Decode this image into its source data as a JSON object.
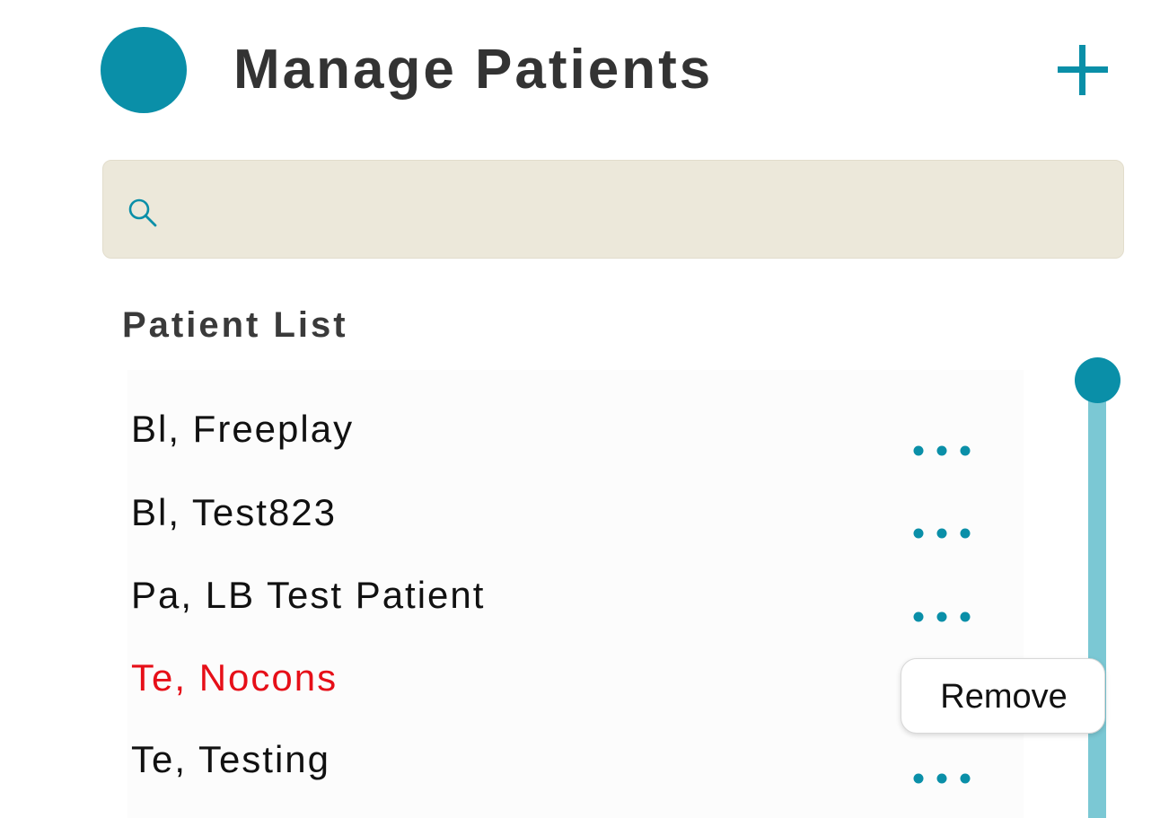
{
  "header": {
    "title": "Manage Patients",
    "avatar_icon": "avatar-circle",
    "add_icon": "plus-icon"
  },
  "search": {
    "placeholder": "",
    "value": "",
    "icon": "search-icon"
  },
  "patient_list": {
    "title": "Patient List",
    "items": [
      {
        "name": "Bl, Freeplay",
        "highlighted": false
      },
      {
        "name": "Bl, Test823",
        "highlighted": false
      },
      {
        "name": "Pa, LB Test Patient",
        "highlighted": false
      },
      {
        "name": "Te, Nocons",
        "highlighted": true
      },
      {
        "name": "Te, Testing",
        "highlighted": false
      }
    ],
    "more_icon": "more-horizontal-icon"
  },
  "context_menu": {
    "items": [
      {
        "label": "Remove"
      }
    ]
  },
  "colors": {
    "accent": "#0a8fa8",
    "accent_light": "#7bc8d4",
    "search_bg": "#ece8da",
    "alert": "#e60f18",
    "text": "#111111",
    "heading": "#333333"
  }
}
